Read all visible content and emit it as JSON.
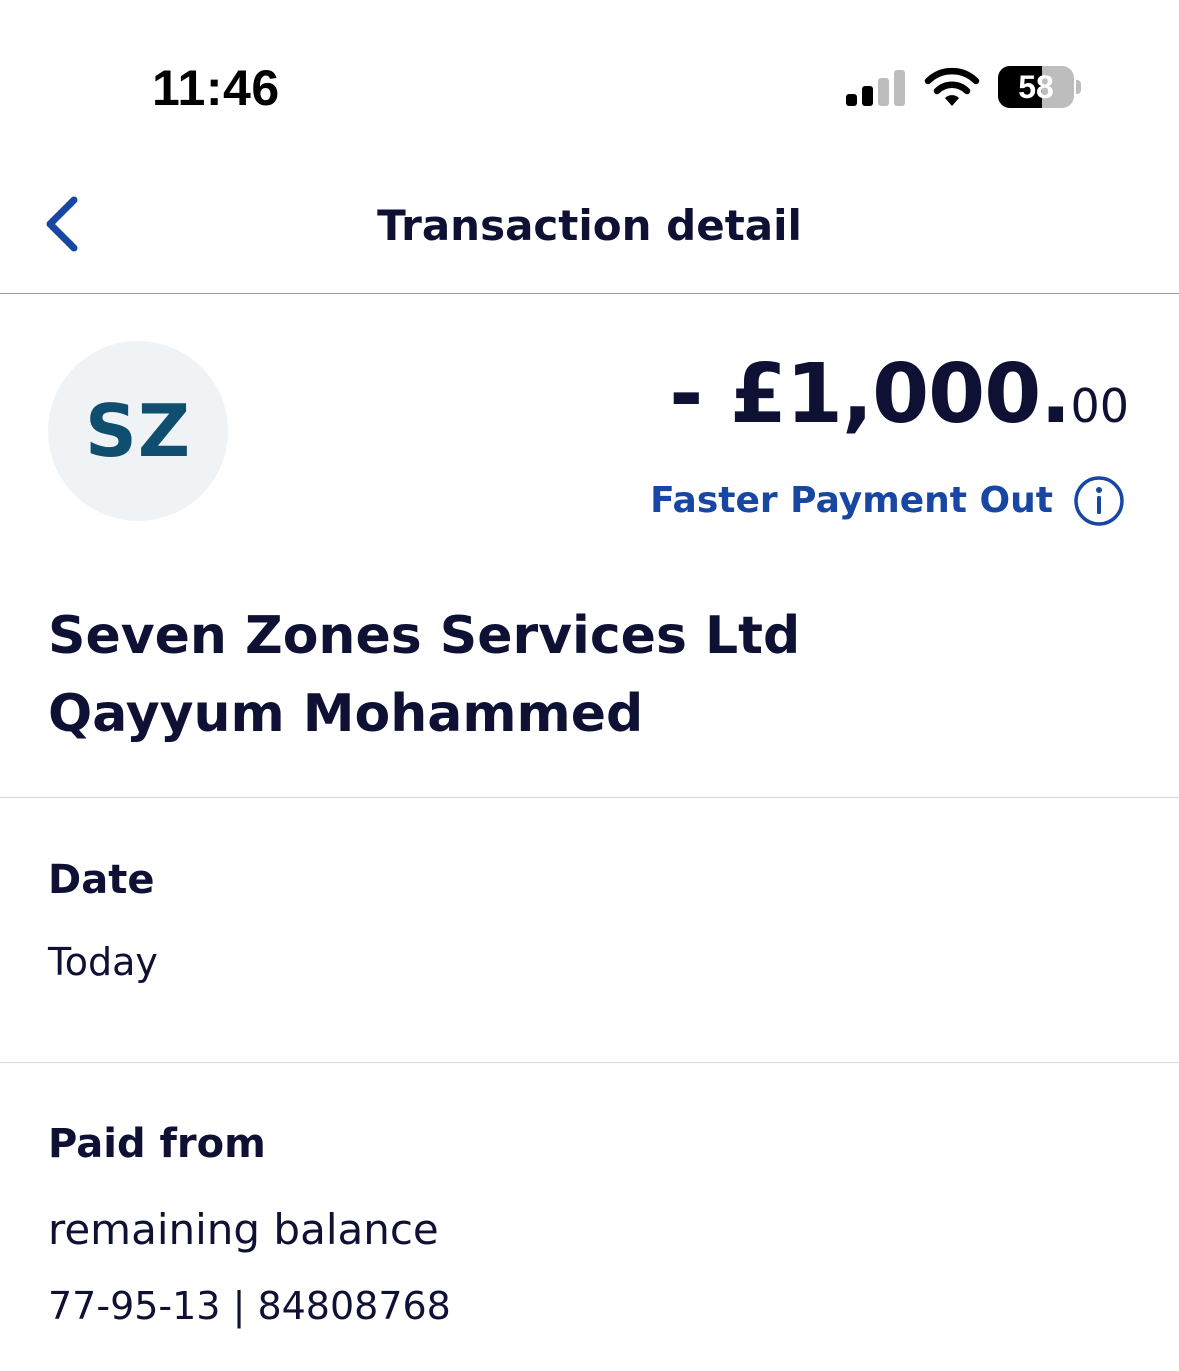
{
  "status_bar": {
    "time": "11:46",
    "battery_percent": "58",
    "battery_level": 0.58,
    "icons": [
      "signal-icon",
      "wifi-icon",
      "battery-icon"
    ]
  },
  "header": {
    "title": "Transaction detail",
    "back_icon": "chevron-left-icon"
  },
  "transaction": {
    "avatar_initials": "SZ",
    "amount_main": "- £1,000.",
    "amount_pence": "00",
    "payment_type": "Faster Payment Out",
    "payee_lines": [
      "Seven Zones Services Ltd",
      "Qayyum Mohammed"
    ]
  },
  "date_section": {
    "label": "Date",
    "value": "Today"
  },
  "paid_from_section": {
    "label": "Paid from",
    "account_name": "remaining balance",
    "account_details": "77-95-13 | 84808768"
  },
  "colors": {
    "text_primary": "#0e1133",
    "accent_blue": "#1846a3",
    "avatar_bg": "#eff3f6",
    "avatar_text": "#0f4e6e",
    "divider": "#d5d7db"
  }
}
